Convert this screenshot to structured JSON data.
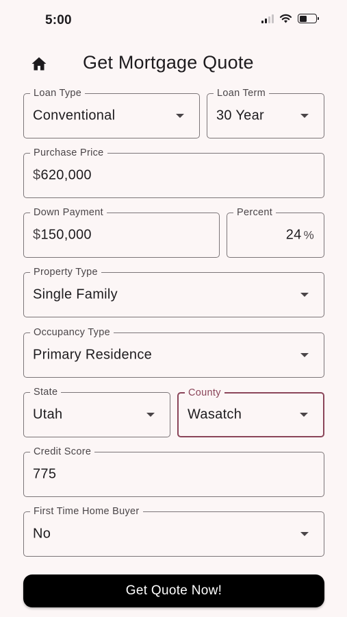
{
  "status": {
    "time": "5:00"
  },
  "header": {
    "title": "Get Mortgage Quote"
  },
  "form": {
    "loan_type": {
      "label": "Loan Type",
      "value": "Conventional"
    },
    "loan_term": {
      "label": "Loan Term",
      "value": "30 Year"
    },
    "purchase_price": {
      "label": "Purchase Price",
      "prefix": "$",
      "value": "620,000"
    },
    "down_payment": {
      "label": "Down Payment",
      "prefix": "$",
      "value": "150,000"
    },
    "percent": {
      "label": "Percent",
      "value": "24",
      "suffix": "%"
    },
    "property_type": {
      "label": "Property Type",
      "value": "Single Family"
    },
    "occupancy_type": {
      "label": "Occupancy Type",
      "value": "Primary Residence"
    },
    "state": {
      "label": "State",
      "value": "Utah"
    },
    "county": {
      "label": "County",
      "value": "Wasatch"
    },
    "credit_score": {
      "label": "Credit Score",
      "value": "775"
    },
    "first_time_buyer": {
      "label": "First Time Home Buyer",
      "value": "No"
    }
  },
  "actions": {
    "submit_label": "Get Quote Now!"
  },
  "colors": {
    "background": "#fcf6f6",
    "focus_accent": "#8a4559",
    "button": "#000000"
  }
}
